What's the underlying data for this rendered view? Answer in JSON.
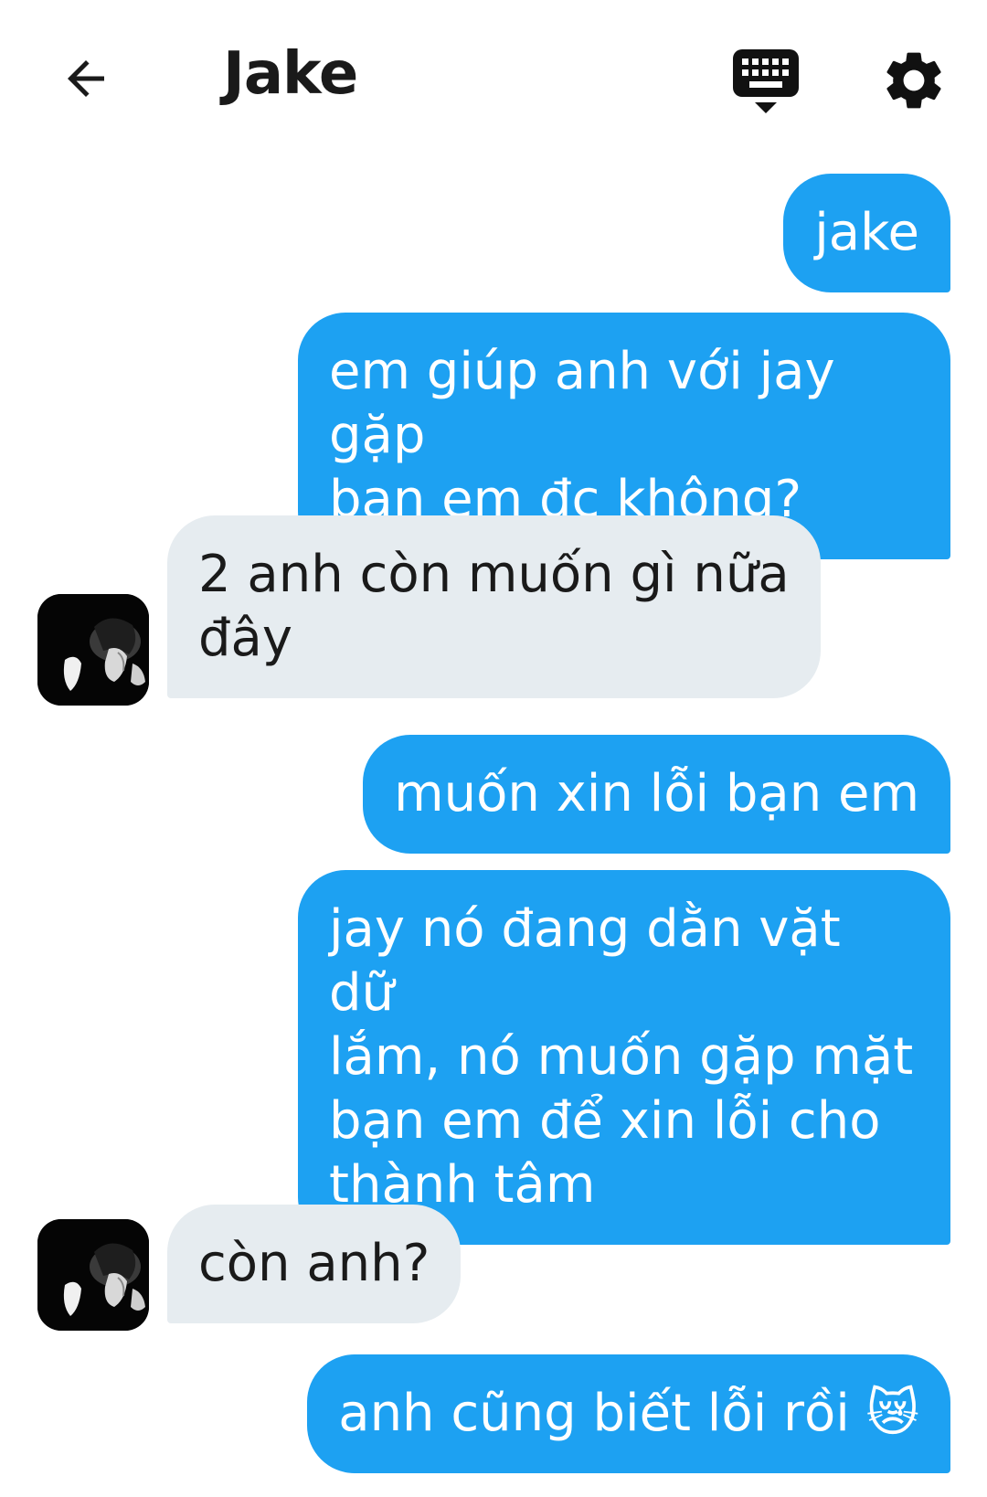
{
  "header": {
    "title": "Jake",
    "back_icon": "arrow-left-icon",
    "keyboard_icon": "keyboard-icon",
    "settings_icon": "gear-icon"
  },
  "messages": [
    {
      "direction": "out",
      "text": "jake"
    },
    {
      "direction": "out",
      "text": "em giúp anh với jay gặp\nbạn em đc không?"
    },
    {
      "direction": "in",
      "text": "2 anh còn muốn gì nữa\nđây"
    },
    {
      "direction": "out",
      "text": "muốn xin lỗi bạn em"
    },
    {
      "direction": "out",
      "text": "jay nó đang dằn vặt dữ\nlắm, nó muốn gặp mặt\nbạn em để xin lỗi cho\nthành tâm"
    },
    {
      "direction": "in",
      "text": "còn anh?"
    },
    {
      "direction": "out",
      "text": "anh cũng biết lỗi rồi 😿"
    }
  ],
  "colors": {
    "outgoing_bubble": "#1da1f2",
    "incoming_bubble": "#e6ecf0",
    "outgoing_text": "#ffffff",
    "incoming_text": "#1a1a1a"
  }
}
